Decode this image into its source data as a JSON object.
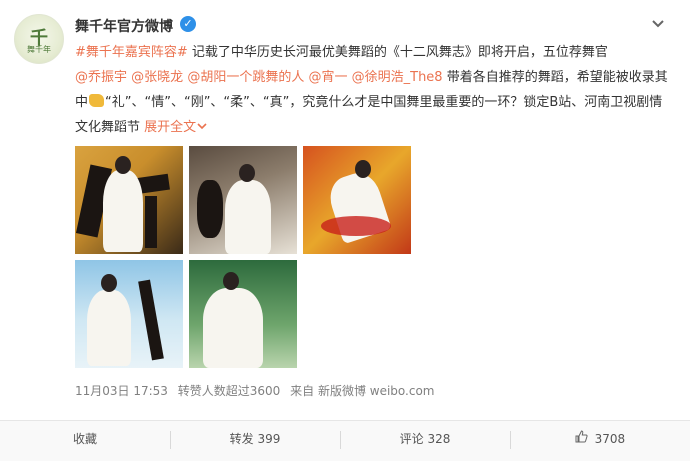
{
  "post": {
    "author": "舞千年官方微博",
    "avatar_text": "千",
    "avatar_sub": "舞千年",
    "verified_icon": "✓",
    "text_part1_link": "#舞千年嘉宾阵容#",
    "text_part1": " 记载了中华历史长河最优美舞蹈的《十二风舞志》即将开启，五位荐舞官",
    "mention1": "@乔振宇",
    "mention2": "@张晓龙",
    "mention3": "@胡阳一个跳舞的人",
    "mention4": "@宵一",
    "mention5": "@徐明浩_The8",
    "text_part2": " 带着各自推荐的舞蹈，希望能被收录其中",
    "text_part3": "“礼”、“情”、“刚”、“柔”、“真”，究竟什么才是中国舞里最重要的一环？锁定B站、河南卫视剧情文化舞蹈节",
    "expand_label": "展开全文",
    "time": "11月03日 17:53",
    "repost_note": "转赞人数超过3600",
    "source": "来自 新版微博 weibo.com"
  },
  "actions": {
    "favorite": "收藏",
    "repost": "转发 399",
    "comment": "评论 328",
    "like": "3708"
  },
  "colors": {
    "link": "#eb7350",
    "verified": "#2e90e8"
  }
}
